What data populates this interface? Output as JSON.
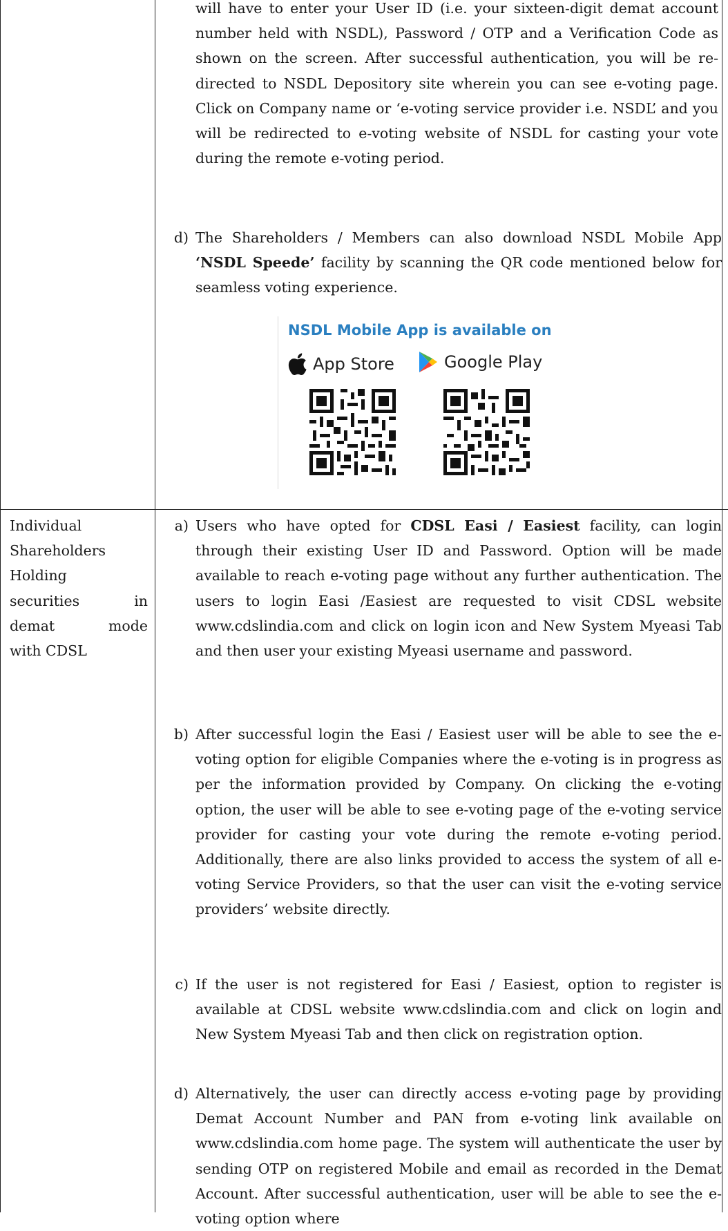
{
  "intro_lines": [
    "will have to enter your User ID (i.e. your sixteen-digit demat account number held with NSDL), Password / OTP and a Verification Code as shown on the screen. After successful authentication, you will be re-directed to NSDL Depository site wherein you can see e-voting page. Click on Company name or ‘e-voting service provider i.e. NSDL’ and you will be redirected to e-voting website of NSDL for casting your vote during the remote e-voting period."
  ],
  "nsdl_d": {
    "label": "d)",
    "text_before": "The Shareholders / Members can also download NSDL Mobile App ",
    "bold": "‘NSDL Speede’",
    "text_after": " facility by scanning the QR code mentioned below for seamless voting experience."
  },
  "app_box": {
    "title": "NSDL Mobile App is available on",
    "app_store": "App Store",
    "google_play": "Google Play",
    "apple_icon": "apple-icon",
    "play_icon": "google-play-icon"
  },
  "cdsl_label": [
    "Individual",
    "Shareholders",
    "Holding",
    "securities in",
    "demat mode",
    "with CDSL"
  ],
  "cdsl_items": [
    {
      "label": "a)",
      "text_before": "Users who have opted for ",
      "bold": "CDSL Easi / Easiest",
      "text_after": " facility, can login through their existing User ID and Password. Option will be made available to reach e-voting page without any further authentication. The users to login Easi /Easiest are requested to visit CDSL website www.cdslindia.com and click on login icon and New System Myeasi Tab and then user your existing Myeasi username and password."
    },
    {
      "label": "b)",
      "text": "After successful login the Easi / Easiest user will be able to see the e-voting option for eligible Companies where the e-voting is in progress as per the information provided by Company. On clicking the e-voting option, the user will be able to see e-voting page of the e-voting service provider for casting your vote during the remote e-voting period. Additionally, there are also links provided to access the system of all e-voting Service Providers, so that the user can visit the e-voting service providers’ website directly."
    },
    {
      "label": "c)",
      "text": "If the user is not registered for Easi / Easiest, option to register is available at CDSL website www.cdslindia.com and click on login and New System Myeasi Tab and then click on registration option."
    },
    {
      "label": "d)",
      "text": "Alternatively, the user can directly access e-voting page by providing Demat Account Number and PAN from e-voting link available on www.cdslindia.com home page. The system will authenticate the user by sending OTP on registered Mobile and email as recorded in the Demat Account. After successful authentication, user will be able to see the e-voting option where"
    }
  ]
}
